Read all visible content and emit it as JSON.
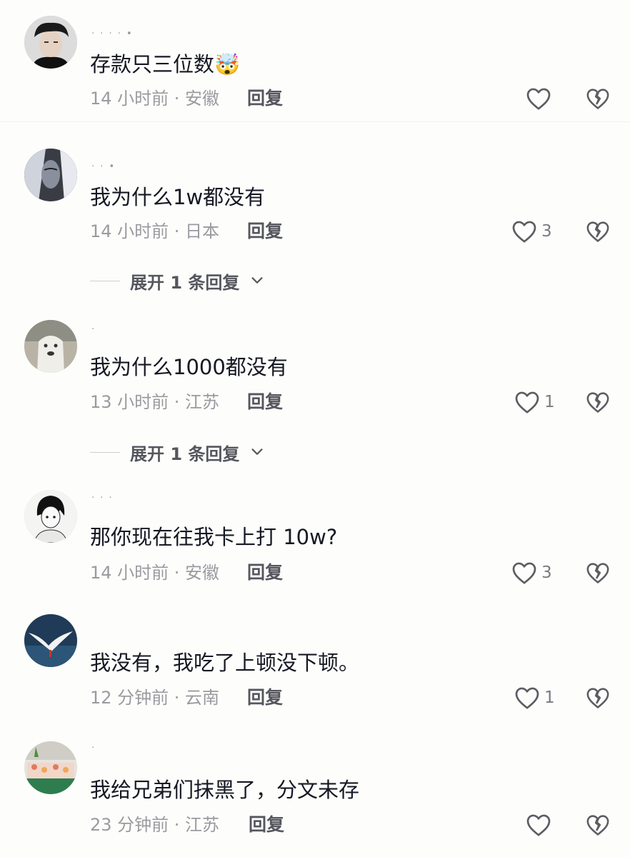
{
  "comments": [
    {
      "username": "· · · · •",
      "text": "存款只三位数",
      "emoji": "🤯",
      "meta": "14 小时前 · 安徽",
      "reply": "回复",
      "likes": ""
    },
    {
      "username": "· · •",
      "text": "我为什么1w都没有",
      "meta": "14 小时前 · 日本",
      "reply": "回复",
      "likes": "3",
      "expand": "展开 1 条回复"
    },
    {
      "username": "·",
      "text": "我为什么1000都没有",
      "meta": "13 小时前 · 江苏",
      "reply": "回复",
      "likes": "1",
      "expand": "展开 1 条回复"
    },
    {
      "username": "· · ·",
      "text": "那你现在往我卡上打 10w?",
      "meta": "14 小时前 · 安徽",
      "reply": "回复",
      "likes": "3"
    },
    {
      "username": "",
      "text": "我没有，我吃了上顿没下顿。",
      "meta": "12 分钟前 · 云南",
      "reply": "回复",
      "likes": "1"
    },
    {
      "username": "·",
      "text": "我给兄弟们抹黑了，分文未存",
      "meta": "23 分钟前 · 江苏",
      "reply": "回复",
      "likes": ""
    }
  ],
  "icons": {
    "like": "heart-outline-icon",
    "dislike": "broken-heart-icon",
    "expand": "chevron-down-icon"
  },
  "colors": {
    "text": "#161823",
    "meta": "#9a9aa0",
    "reply": "#55565e",
    "icon": "#5c5d63"
  }
}
